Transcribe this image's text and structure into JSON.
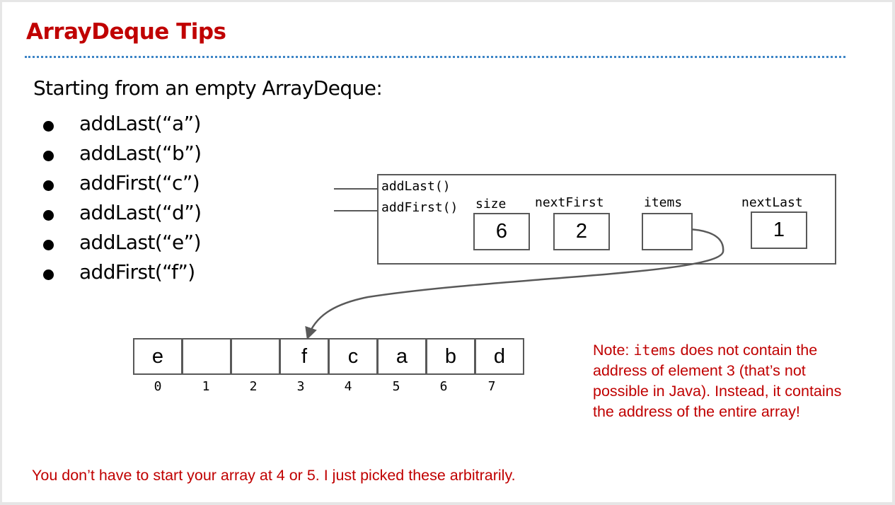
{
  "title": "ArrayDeque Tips",
  "intro": "Starting from an empty ArrayDeque:",
  "operations": [
    "addLast(“a”)",
    "addLast(“b”)",
    "addFirst(“c”)",
    "addLast(“d”)",
    "addLast(“e”)",
    "addFirst(“f”)"
  ],
  "object": {
    "methods": [
      "addLast()",
      "addFirst()"
    ],
    "fields": [
      {
        "name": "size",
        "value": "6"
      },
      {
        "name": "nextFirst",
        "value": "2"
      },
      {
        "name": "items",
        "value": ""
      },
      {
        "name": "nextLast",
        "value": "1"
      }
    ]
  },
  "array": {
    "cells": [
      "e",
      "",
      "",
      "f",
      "c",
      "a",
      "b",
      "d"
    ],
    "indices": [
      "0",
      "1",
      "2",
      "3",
      "4",
      "5",
      "6",
      "7"
    ]
  },
  "note": {
    "prefix": "Note: ",
    "code": "items",
    "rest": " does not contain the address of element 3 (that’s not possible in Java). Instead, it contains the address of the entire array!"
  },
  "footer": "You don’t have to start your array at 4 or 5. I just picked these arbitrarily.",
  "colors": {
    "accent_red": "#c00000",
    "rule_blue": "#3d85c6",
    "box_border": "#595959"
  }
}
